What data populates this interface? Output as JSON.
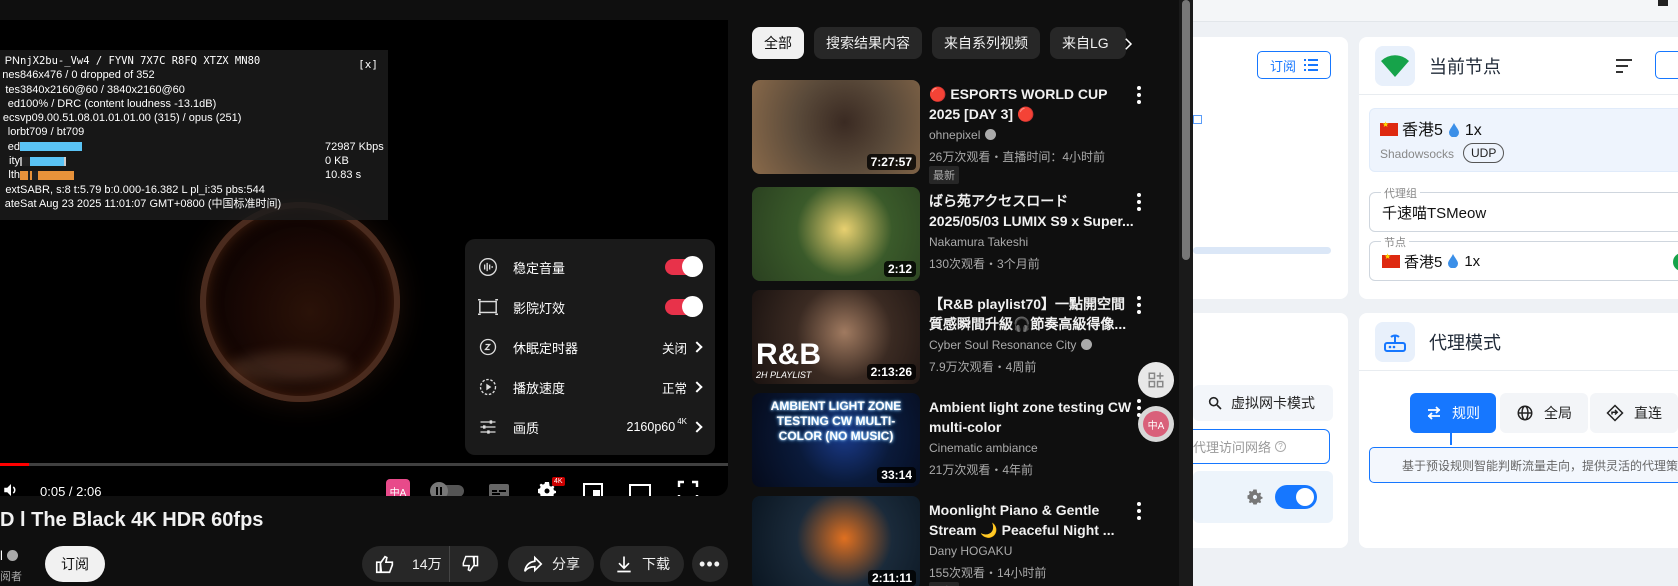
{
  "player": {
    "stats_close": "[x]",
    "stats": [
      {
        "label": "PN",
        "value": "njX2bu-_Vw4 / FYVN 7X7C R8FQ XTZX MN80",
        "mono": true
      },
      {
        "label": "nes",
        "value": "846x476 / 0 dropped of 352",
        "mono": false
      },
      {
        "label": "tes",
        "value": "3840x2160@60 / 3840x2160@60",
        "mono": false
      },
      {
        "label": "ed",
        "value": "100% / DRC (content loudness -13.1dB)",
        "mono": false
      },
      {
        "label": "ecs",
        "value": "vp09.00.51.08.01.01.01.00 (315) / opus (251)",
        "mono": false
      },
      {
        "label": "lor",
        "value": "bt709 / bt709",
        "mono": false
      },
      {
        "label": "ed",
        "value": "",
        "bar": "speed",
        "barval": "72987 Kbps"
      },
      {
        "label": "ity",
        "value": "",
        "bar": "activity",
        "barval": "0 KB"
      },
      {
        "label": "lth",
        "value": "",
        "bar": "health",
        "barval": "10.83 s"
      },
      {
        "label": "ext",
        "value": "SABR, s:8 t:5.79 b:0.000-16.382 L pl_i:35 pbs:544",
        "mono": false
      },
      {
        "label": "ate",
        "value": "Sat Aug 23 2025 11:01:07 GMT+0800 (中国标准时间)",
        "mono": false
      }
    ],
    "settings": [
      {
        "icon": "stable-volume-icon",
        "label": "稳定音量",
        "value": "",
        "toggle": true
      },
      {
        "icon": "ambient-mode-icon",
        "label": "影院灯效",
        "value": "",
        "toggle": true
      },
      {
        "icon": "sleep-timer-icon",
        "label": "休眠定时器",
        "value": "关闭",
        "toggle": false
      },
      {
        "icon": "playback-speed-icon",
        "label": "播放速度",
        "value": "正常",
        "toggle": false
      },
      {
        "icon": "quality-icon",
        "label": "画质",
        "value": "2160p60",
        "sup": "4K",
        "toggle": false
      }
    ],
    "time": "0:05 / 2:06",
    "progress": 0.04,
    "hd_badge": "4K"
  },
  "video": {
    "title": "D l The Black 4K HDR 60fps",
    "channel_stub": "l",
    "subs_stub": "阅者",
    "subscribe_label": "订阅",
    "likes": "14万",
    "share_label": "分享",
    "download_label": "下载"
  },
  "chips": [
    "全部",
    "搜索结果内容",
    "来自系列视频",
    "来自LG"
  ],
  "recommendations": [
    {
      "title": "🔴 ESPORTS WORLD CUP 2025 [DAY 3] 🔴",
      "channel": "ohnepixel",
      "verified": true,
      "meta": "26万次观看・直播时间：4小时前",
      "badge": "最新",
      "duration": "7:27:57",
      "thumb_colors": [
        "#5a4a3a",
        "#3a2a22",
        "#8a6a4a"
      ]
    },
    {
      "title": "ばら苑アクセスロード 2025/05/03 LUMIX S9 x Super...",
      "channel": "Nakamura Takeshi",
      "verified": false,
      "meta": "130次观看・3个月前",
      "badge": "",
      "duration": "2:12",
      "thumb_colors": [
        "#3a5a2a",
        "#e8d070",
        "#2a4020"
      ]
    },
    {
      "title": "【R&B playlist70】一點開空間質感瞬間升級🎧節奏高級得像...",
      "channel": "Cyber Soul Resonance City",
      "verified": true,
      "meta": "7.9万次观看・4周前",
      "badge": "",
      "duration": "2:13:26",
      "thumb_colors": [
        "#3a2a22",
        "#a07a60",
        "#1a1210"
      ],
      "thumb_text": "R&B",
      "thumb_sub": "2H PLAYLIST"
    },
    {
      "title": "Ambient light zone testing CW multi-color",
      "channel": "Cinematic ambiance",
      "verified": false,
      "meta": "21万次观看・4年前",
      "badge": "",
      "duration": "33:14",
      "thumb_colors": [
        "#0a1a3a",
        "#1a3a8a",
        "#050a1a"
      ],
      "thumb_text": "AMBIENT LIGHT ZONE TESTING CW MULTI-COLOR (NO MUSIC)"
    },
    {
      "title": "Moonlight Piano & Gentle Stream 🌙 Peaceful Night ...",
      "channel": "Dany HOGAKU",
      "verified": false,
      "meta": "155次观看・14小时前",
      "badge": "最新",
      "duration": "2:11:11",
      "thumb_colors": [
        "#1a2a3a",
        "#e07020",
        "#0a1520"
      ]
    }
  ],
  "clash": {
    "subscribe_label": "订阅",
    "node_card": {
      "title": "当前节点",
      "node_name": "香港5",
      "multiplier": "1x",
      "protocol": "Shadowsocks",
      "udp": "UDP",
      "group_label": "代理组",
      "group_value": "千速喵TSMeow",
      "node_label": "节点",
      "node_value": "香港5",
      "node_value_mult": "1x"
    },
    "left_card": {
      "tun_label": "虚拟网卡模式",
      "proxy_label": "代理访问网络"
    },
    "mode_card": {
      "title": "代理模式",
      "modes": [
        "规则",
        "全局",
        "直连"
      ],
      "active_mode": "规则",
      "description": "基于预设规则智能判断流量走向，提供灵活的代理策"
    },
    "colors": {
      "accent": "#1677ff",
      "node_green": "#16a34a"
    }
  }
}
